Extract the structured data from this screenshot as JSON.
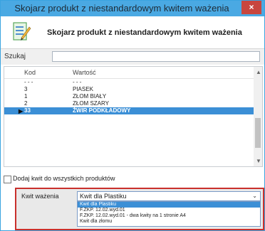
{
  "window": {
    "title": "Skojarz produkt z niestandardowym kwitem ważenia",
    "close_glyph": "×"
  },
  "header": {
    "title": "Skojarz produkt z niestandardowym kwitem ważenia",
    "icon": "edit-list-icon"
  },
  "search": {
    "label": "Szukaj",
    "value": ""
  },
  "grid": {
    "columns": [
      "Kod",
      "Wartość"
    ],
    "rows": [
      {
        "kod": "- - -",
        "wartosc": "- - -"
      },
      {
        "kod": "3",
        "wartosc": "PIASEK"
      },
      {
        "kod": "1",
        "wartosc": "ZŁOM BIAŁY"
      },
      {
        "kod": "2",
        "wartosc": "ZŁOM SZARY"
      },
      {
        "kod": "33",
        "wartosc": "ŻWIR PODKŁADOWY"
      }
    ],
    "selected_row": 4,
    "current_marker": "▶"
  },
  "checkbox": {
    "label": "Dodaj kwit do wszystkich produktów",
    "checked": false
  },
  "kwit": {
    "label": "Kwit ważenia",
    "selected": "Kwit dla Plastiku",
    "arrow": "⌄",
    "options": [
      "Kwit dla Plastiku",
      "F.ZKP. 12.02.wyd.01",
      "F.ZKP. 12.02.wyd.01 - dwa kwity na 1 stronie A4",
      "Kwit dla złomu"
    ],
    "highlighted_option": 0
  }
}
